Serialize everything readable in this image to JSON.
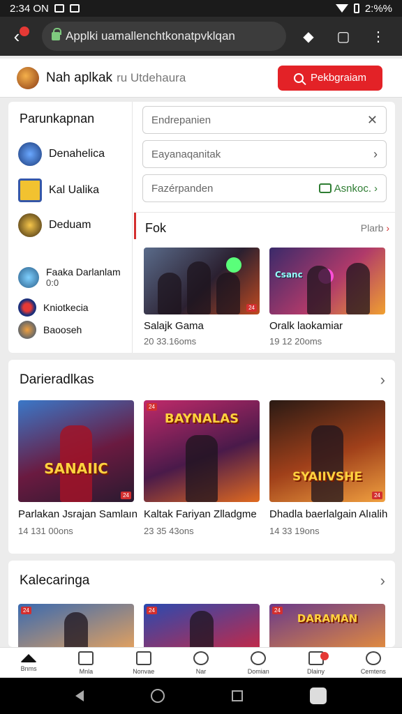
{
  "statusbar": {
    "time": "2:34 ON",
    "battery": "2:%%"
  },
  "browser": {
    "url": "Applki uamallenchtkonatpvklqan"
  },
  "header": {
    "title": "Nah aplkak",
    "subtitle": "ru Utdehaura",
    "search_label": "Pekbgraiam"
  },
  "sidebar": {
    "title": "Parunkapnan",
    "items": [
      {
        "label": "Denahelica"
      },
      {
        "label": "Kal Ualika"
      },
      {
        "label": "Deduam"
      },
      {
        "label": "Faaka Darlanlam",
        "sub": "0:0"
      },
      {
        "label": "Kniotkecia"
      },
      {
        "label": "Baooseh"
      }
    ]
  },
  "filters": [
    {
      "placeholder": "Endrepanien"
    },
    {
      "placeholder": "Eayanaqanitak"
    },
    {
      "placeholder": "Fazérpanden",
      "pill": "Asnkoc."
    }
  ],
  "featured": {
    "title": "Fok",
    "more": "Plarb",
    "cards": [
      {
        "name": "Salajk Gama",
        "meta": "20 33.16oms",
        "tag": "24"
      },
      {
        "name": "Oralk laokamiar",
        "meta": "19 12 20oms",
        "tag": "24",
        "overlay": "Csanc"
      }
    ]
  },
  "section1": {
    "title": "Darieradlkas",
    "cards": [
      {
        "name": "Parlakan Jsrajan Samlaın",
        "meta": "14 131 00ons",
        "overlay": "SANAIIC",
        "tag": "24"
      },
      {
        "name": "Kaltak Fariyan Zlladgme",
        "meta": "23 35 43ons",
        "overlay": "BAYNALAS",
        "tag": "24"
      },
      {
        "name": "Dhadla baerlalgain Alıalih",
        "meta": "14 33 19ons",
        "overlay": "SYAIIVSHE",
        "tag": "24"
      }
    ]
  },
  "section2": {
    "title": "Kalecaringa",
    "cards": [
      {
        "tag": "24"
      },
      {
        "tag": "24"
      },
      {
        "tag": "24",
        "overlay": "DARAMAN"
      }
    ]
  },
  "bottomnav": [
    {
      "label": "Bnms",
      "icon": "home-icon"
    },
    {
      "label": "Mnla",
      "icon": "list-icon"
    },
    {
      "label": "Nonvae",
      "icon": "close-box-icon"
    },
    {
      "label": "Nar",
      "icon": "heart-icon"
    },
    {
      "label": "Domian",
      "icon": "user-icon"
    },
    {
      "label": "Dlainy",
      "icon": "cart-icon"
    },
    {
      "label": "Cemtens",
      "icon": "person-icon"
    }
  ],
  "colors": {
    "accent": "#e32227",
    "green": "#2e7d32"
  }
}
